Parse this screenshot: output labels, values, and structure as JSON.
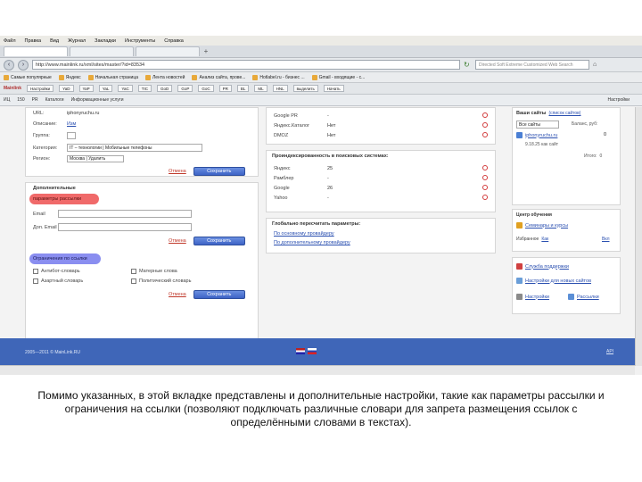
{
  "browser": {
    "menu": [
      "Файл",
      "Правка",
      "Вид",
      "Журнал",
      "Закладки",
      "Инструменты",
      "Справка"
    ],
    "tabs": [
      {
        "label": ""
      },
      {
        "label": ""
      },
      {
        "label": ""
      }
    ],
    "url": "http://www.mainlink.ru/xml/sites/master/?id=83534",
    "search_placeholder": "Directed Soft Extreme Customized Web Search",
    "bookmarks": [
      "Самые популярные",
      "Яндекс",
      "Начальная страница",
      "Лента новостей",
      "Анализ сайта, прове...",
      "Hotlabel.ru - бизнес ...",
      "Gmail - входящие - c..."
    ],
    "toolbar2": {
      "brand": "Mainlink",
      "items": [
        "Настройки",
        "YaD",
        "YaP",
        "YaL",
        "YaC",
        "TIC",
        "GoD",
        "GoP",
        "GoC",
        "PR",
        "BL",
        "ML",
        "HNL",
        "выделить",
        "Начать"
      ]
    },
    "toolbar3": {
      "items": [
        "ИЦ",
        "150",
        "PR",
        "Каталоги",
        "Информационные услуги"
      ],
      "right": "Настройки"
    }
  },
  "left_panel": {
    "fields": [
      {
        "label": "URL:",
        "value": "iphonyruchu.ru"
      },
      {
        "label": "Описание:",
        "value": "Изм"
      },
      {
        "label": "Группа:",
        "value": ""
      },
      {
        "label": "Категория:",
        "value": "IT – технологии | Мобильные телефоны"
      },
      {
        "label": "Регион:",
        "value": "Москва | Удалить"
      }
    ],
    "cancel_label": "Отмена",
    "save_label": "Сохранить",
    "additional_title": "Дополнительные",
    "mailing_highlight": "параметры рассылки",
    "email_label": "Email",
    "email_value": "",
    "email2_label": "Доп. Email",
    "links_highlight": "Ограничения по ссылки",
    "checkboxes": [
      "Антибот-словарь",
      "Матерные слова",
      "Азартный словарь",
      "Политический словарь"
    ]
  },
  "middle_panel": {
    "top_rows": [
      {
        "label": "Google PR",
        "value": "-"
      },
      {
        "label": "Яндекс.Каталог",
        "value": "Нет"
      },
      {
        "label": "DMOZ",
        "value": "Нет"
      }
    ],
    "search_title": "Проиндексированность в поисковых системах:",
    "search_rows": [
      {
        "label": "Яндекс",
        "value": "25"
      },
      {
        "label": "Рамблер",
        "value": "-"
      },
      {
        "label": "Google",
        "value": "26"
      },
      {
        "label": "Yahoo",
        "value": "-"
      }
    ],
    "recalc_title": "Глобально пересчитать параметры:",
    "recalc_links": [
      "По основному провайдеру",
      "По дополнительному провайдеру"
    ]
  },
  "right_panel": {
    "sites_title": "Ваши сайты",
    "sites_link": "(список сайтов)",
    "select_label": "Все сайты",
    "site_name": "iphonyruchu.ru",
    "site_desc": "9.18.25 как сайт",
    "balance_label": "Баланс, руб:",
    "balance_value": "0",
    "total_label": "Итого:",
    "total_value": "0",
    "training_title": "Центр обучения",
    "training_link": "Семинары и курсы",
    "favorites_label": "Избранное",
    "favorites_link": "Как",
    "favorites_right": "Вкл",
    "support_links": [
      "Служба поддержки",
      "Настройки для новых сайтов",
      "Настройки",
      "Рассылки"
    ]
  },
  "footer": {
    "copyright": "2005—2011 © MainLink.RU",
    "api_link": "API"
  },
  "caption": "Помимо указанных, в этой вкладке представлены и дополнительные настройки, такие как параметры рассылки и ограничения на ссылки (позволяют подключать различные словари для запрета размещения ссылок с определёнными словами в текстах)."
}
